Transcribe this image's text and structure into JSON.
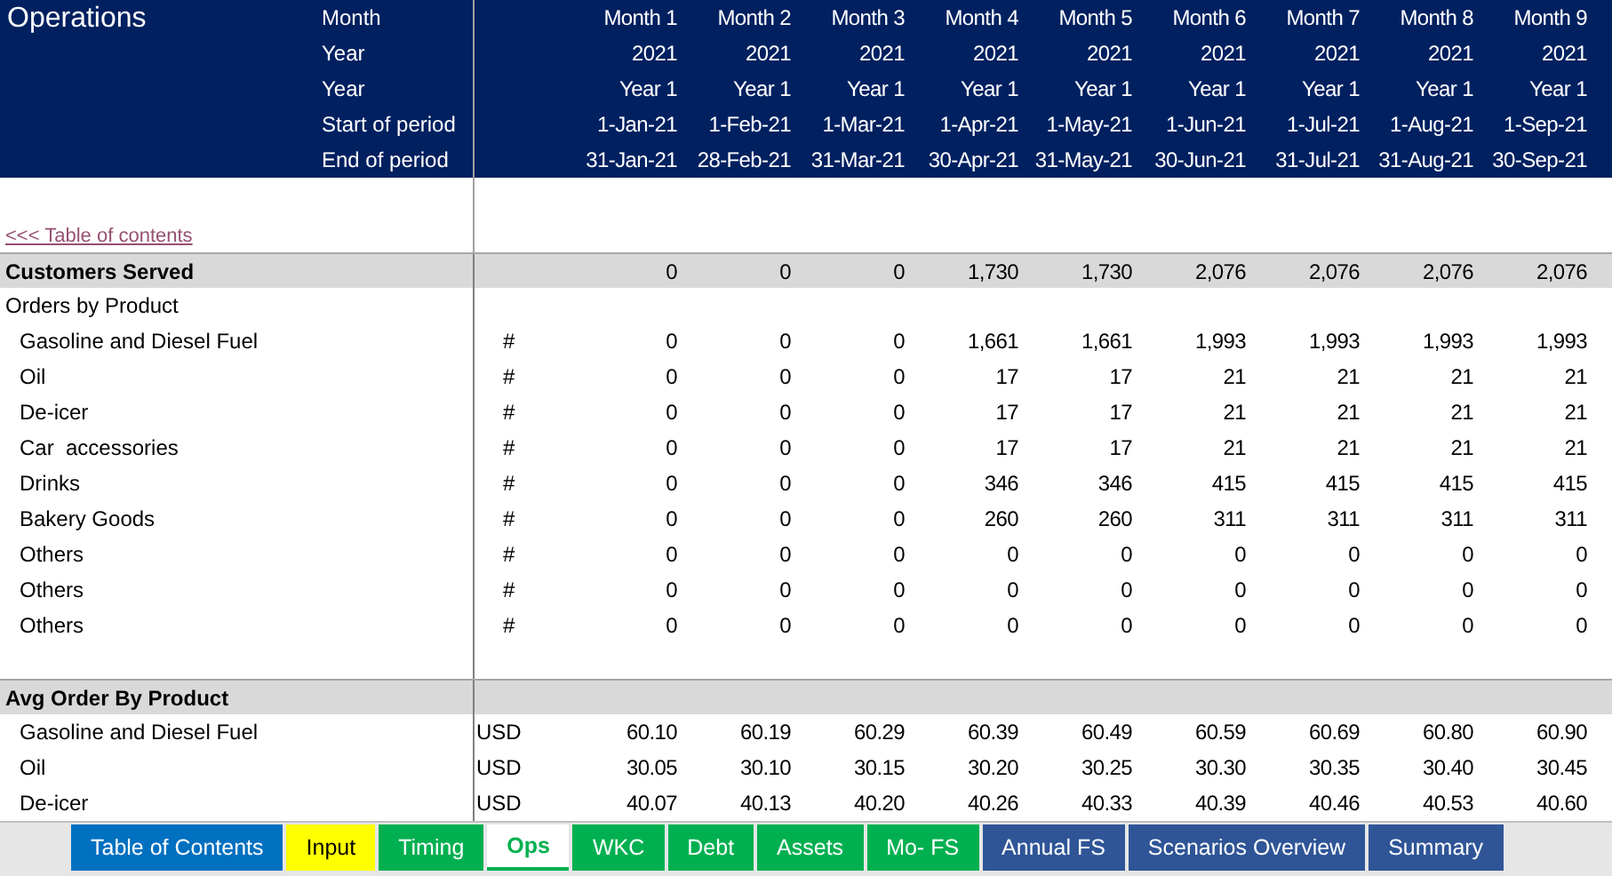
{
  "title": "Operations",
  "header_rows": [
    {
      "label": "Month",
      "values": [
        "Month 1",
        "Month 2",
        "Month 3",
        "Month 4",
        "Month 5",
        "Month 6",
        "Month 7",
        "Month 8",
        "Month 9"
      ]
    },
    {
      "label": "Year",
      "values": [
        "2021",
        "2021",
        "2021",
        "2021",
        "2021",
        "2021",
        "2021",
        "2021",
        "2021"
      ]
    },
    {
      "label": "Year",
      "values": [
        "Year 1",
        "Year 1",
        "Year 1",
        "Year 1",
        "Year 1",
        "Year 1",
        "Year 1",
        "Year 1",
        "Year 1"
      ]
    },
    {
      "label": "Start of period",
      "values": [
        "1-Jan-21",
        "1-Feb-21",
        "1-Mar-21",
        "1-Apr-21",
        "1-May-21",
        "1-Jun-21",
        "1-Jul-21",
        "1-Aug-21",
        "1-Sep-21"
      ]
    },
    {
      "label": "End of period",
      "values": [
        "31-Jan-21",
        "28-Feb-21",
        "31-Mar-21",
        "30-Apr-21",
        "31-May-21",
        "30-Jun-21",
        "31-Jul-21",
        "31-Aug-21",
        "30-Sep-21"
      ]
    }
  ],
  "link": "<<< Table of contents",
  "rows": [
    {
      "kind": "section",
      "label": "Customers Served",
      "values": [
        "0",
        "0",
        "0",
        "1,730",
        "1,730",
        "2,076",
        "2,076",
        "2,076",
        "2,076"
      ]
    },
    {
      "kind": "subheading",
      "label": "Orders by Product"
    },
    {
      "kind": "item",
      "label": "Gasoline and Diesel Fuel",
      "unit": "#",
      "values": [
        "0",
        "0",
        "0",
        "1,661",
        "1,661",
        "1,993",
        "1,993",
        "1,993",
        "1,993"
      ]
    },
    {
      "kind": "item",
      "label": "Oil",
      "unit": "#",
      "values": [
        "0",
        "0",
        "0",
        "17",
        "17",
        "21",
        "21",
        "21",
        "21"
      ]
    },
    {
      "kind": "item",
      "label": "De-icer",
      "unit": "#",
      "values": [
        "0",
        "0",
        "0",
        "17",
        "17",
        "21",
        "21",
        "21",
        "21"
      ]
    },
    {
      "kind": "item",
      "label": "Car  accessories",
      "unit": "#",
      "values": [
        "0",
        "0",
        "0",
        "17",
        "17",
        "21",
        "21",
        "21",
        "21"
      ]
    },
    {
      "kind": "item",
      "label": "Drinks",
      "unit": "#",
      "values": [
        "0",
        "0",
        "0",
        "346",
        "346",
        "415",
        "415",
        "415",
        "415"
      ]
    },
    {
      "kind": "item",
      "label": "Bakery Goods",
      "unit": "#",
      "values": [
        "0",
        "0",
        "0",
        "260",
        "260",
        "311",
        "311",
        "311",
        "311"
      ]
    },
    {
      "kind": "item",
      "label": "Others",
      "unit": "#",
      "values": [
        "0",
        "0",
        "0",
        "0",
        "0",
        "0",
        "0",
        "0",
        "0"
      ]
    },
    {
      "kind": "item",
      "label": "Others",
      "unit": "#",
      "values": [
        "0",
        "0",
        "0",
        "0",
        "0",
        "0",
        "0",
        "0",
        "0"
      ]
    },
    {
      "kind": "item",
      "label": "Others",
      "unit": "#",
      "values": [
        "0",
        "0",
        "0",
        "0",
        "0",
        "0",
        "0",
        "0",
        "0"
      ]
    },
    {
      "kind": "blank"
    },
    {
      "kind": "section",
      "label": "Avg Order By Product"
    },
    {
      "kind": "item",
      "label": "Gasoline and Diesel Fuel",
      "unit": "USD",
      "values": [
        "60.10",
        "60.19",
        "60.29",
        "60.39",
        "60.49",
        "60.59",
        "60.69",
        "60.80",
        "60.90"
      ]
    },
    {
      "kind": "item",
      "label": "Oil",
      "unit": "USD",
      "values": [
        "30.05",
        "30.10",
        "30.15",
        "30.20",
        "30.25",
        "30.30",
        "30.35",
        "30.40",
        "30.45"
      ]
    },
    {
      "kind": "item",
      "label": "De-icer",
      "unit": "USD",
      "values": [
        "40.07",
        "40.13",
        "40.20",
        "40.26",
        "40.33",
        "40.39",
        "40.46",
        "40.53",
        "40.60"
      ]
    }
  ],
  "sheet_tabs": [
    {
      "label": "Table of Contents",
      "color": "#0070c0",
      "selected": false
    },
    {
      "label": "Input",
      "color": "#ffff00",
      "selected": false
    },
    {
      "label": "Timing",
      "color": "#00b050",
      "selected": false
    },
    {
      "label": "Ops",
      "color": "#00b050",
      "selected": true
    },
    {
      "label": "WKC",
      "color": "#00b050",
      "selected": false
    },
    {
      "label": "Debt",
      "color": "#00b050",
      "selected": false
    },
    {
      "label": "Assets",
      "color": "#00b050",
      "selected": false
    },
    {
      "label": "Mo- FS",
      "color": "#00b050",
      "selected": false
    },
    {
      "label": "Annual FS",
      "color": "#2f5597",
      "selected": false
    },
    {
      "label": "Scenarios Overview",
      "color": "#2f5597",
      "selected": false
    },
    {
      "label": "Summary",
      "color": "#2f5597",
      "selected": false
    }
  ]
}
